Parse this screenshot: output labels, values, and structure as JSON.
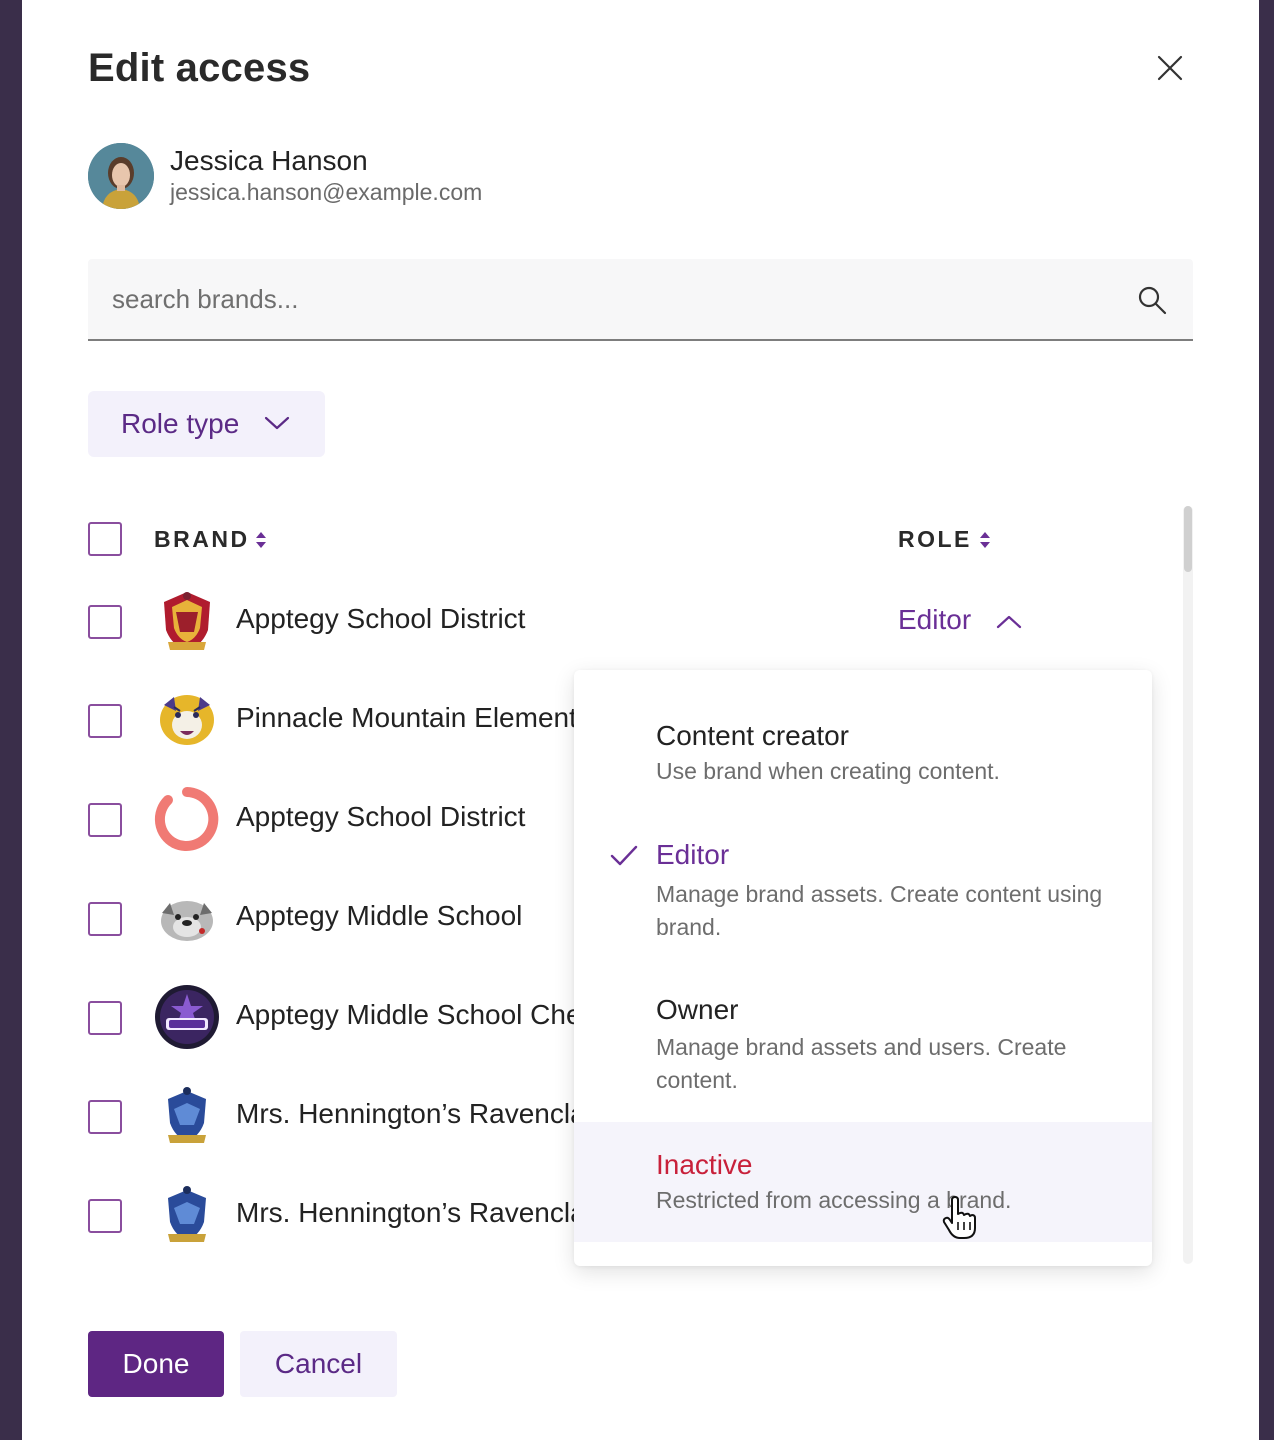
{
  "modal": {
    "title": "Edit access",
    "close_icon": "close-icon"
  },
  "user": {
    "name": "Jessica Hanson",
    "email": "jessica.hanson@example.com"
  },
  "search": {
    "placeholder": "search brands...",
    "icon": "search-icon"
  },
  "filter": {
    "role_type_label": "Role type"
  },
  "table": {
    "columns": {
      "brand": "BRAND",
      "role": "ROLE"
    },
    "rows": [
      {
        "name": "Apptegy School District",
        "logo": "crest-logo",
        "role": "Editor"
      },
      {
        "name": "Pinnacle Mountain Elementary",
        "logo": "tiger-logo"
      },
      {
        "name": "Apptegy School District",
        "logo": "ring-logo"
      },
      {
        "name": "Apptegy Middle School",
        "logo": "bulldog-logo"
      },
      {
        "name": "Apptegy Middle School Cheer",
        "logo": "cheer-logo"
      },
      {
        "name": "Mrs. Hennington’s Ravenclaw",
        "logo": "raven-crest-logo"
      },
      {
        "name": "Mrs. Hennington’s Ravenclaw",
        "logo": "raven-crest-logo"
      }
    ]
  },
  "role_menu": {
    "options": [
      {
        "title": "Content creator",
        "description": "Use brand when creating content."
      },
      {
        "title": "Editor",
        "description": "Manage brand assets. Create content using brand.",
        "selected": true
      },
      {
        "title": "Owner",
        "description": "Manage brand assets and users. Create content."
      },
      {
        "title": "Inactive",
        "description": "Restricted from accessing a brand.",
        "hovered": true
      }
    ]
  },
  "actions": {
    "done": "Done",
    "cancel": "Cancel"
  },
  "colors": {
    "accent": "#5e2683",
    "accent_light": "#f3f1fb",
    "danger": "#c8203a",
    "backdrop": "#3a2e4a"
  }
}
